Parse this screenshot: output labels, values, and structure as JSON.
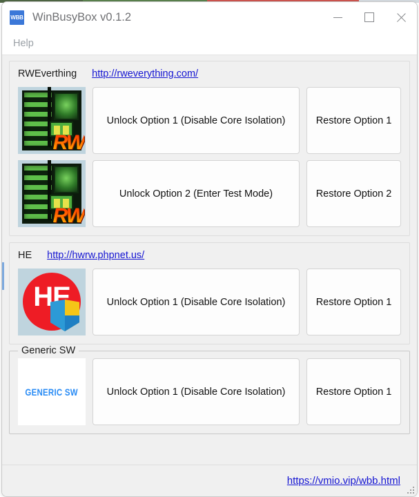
{
  "window": {
    "title": "WinBusyBox v0.1.2",
    "icon_label": "WBB",
    "icon_name": "app-icon-wbb",
    "accent_color": "#3b78d8",
    "link_color": "#1414d2",
    "controls": {
      "minimize": "minimize-icon",
      "maximize": "maximize-icon",
      "close": "close-icon"
    }
  },
  "menubar": {
    "items": [
      {
        "label": "Help"
      }
    ]
  },
  "sections": [
    {
      "title": "RWEverthing",
      "url": "http://rweverything.com/",
      "logo_name": "rweverything-logo",
      "logo_text": "RW",
      "rows": [
        {
          "unlock": "Unlock Option 1 (Disable Core Isolation)",
          "restore": "Restore Option 1"
        },
        {
          "unlock": "Unlock Option 2 (Enter Test Mode)",
          "restore": "Restore Option 2"
        }
      ]
    },
    {
      "title": "HE",
      "url": "http://hwrw.phpnet.us/",
      "logo_name": "he-logo",
      "logo_text": "HE",
      "rows": [
        {
          "unlock": "Unlock Option 1 (Disable Core Isolation)",
          "restore": "Restore Option 1"
        }
      ]
    },
    {
      "title": "Generic SW",
      "url": "",
      "logo_name": "generic-sw-logo",
      "logo_text": "GENERIC SW",
      "rows": [
        {
          "unlock": "Unlock Option 1 (Disable Core Isolation)",
          "restore": "Restore Option 1"
        }
      ]
    }
  ],
  "statusbar": {
    "link": "https://vmio.vip/wbb.html",
    "grip": "resize-grip-icon"
  }
}
